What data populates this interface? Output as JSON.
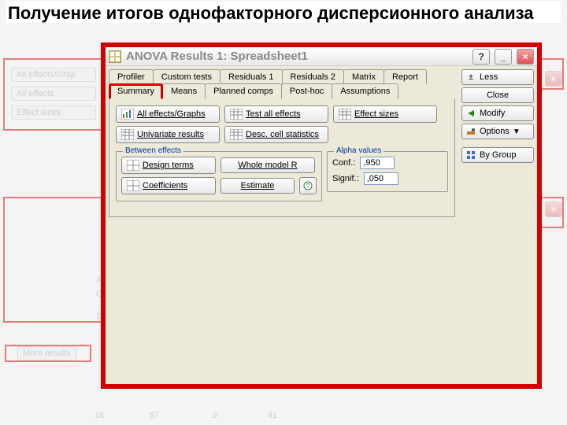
{
  "slide_title": "Получение итогов однофакторного дисперсионного анализа",
  "ghost": {
    "left_buttons": [
      "All effects/Grap",
      "All effects",
      "Effect sizes"
    ],
    "bottom_labels": [
      "Al",
      "Co",
      "Sig"
    ],
    "more_results": "More results",
    "axis_nums": [
      "16",
      "57",
      "2",
      "41"
    ]
  },
  "dialog": {
    "title": "ANOVA Results 1: Spreadsheet1",
    "tabs_row1": [
      "Profiler",
      "Custom tests",
      "Residuals 1",
      "Residuals 2",
      "Matrix",
      "Report"
    ],
    "tabs_row2": [
      "Summary",
      "Means",
      "Planned comps",
      "Post-hoc",
      "Assumptions"
    ],
    "active_tab": "Summary",
    "buttons": {
      "all_effects": "All effects/Graphs",
      "test_all": "Test all effects",
      "effect_sizes": "Effect sizes",
      "univariate": "Univariate results",
      "desc_cell": "Desc. cell statistics",
      "design_terms": "Design terms",
      "whole_model": "Whole model R",
      "coefficients": "Coefficients",
      "estimate": "Estimate"
    },
    "groups": {
      "between": "Between effects",
      "alpha": "Alpha values"
    },
    "alpha": {
      "conf_label": "Conf.:",
      "conf_value": ",950",
      "signif_label": "Signif.:",
      "signif_value": ",050"
    },
    "side": {
      "less": "Less",
      "close": "Close",
      "modify": "Modify",
      "options": "Options",
      "bygroup": "By Group"
    },
    "window": {
      "help": "?",
      "min": "_",
      "close": "×"
    },
    "expand_marker": "±"
  }
}
